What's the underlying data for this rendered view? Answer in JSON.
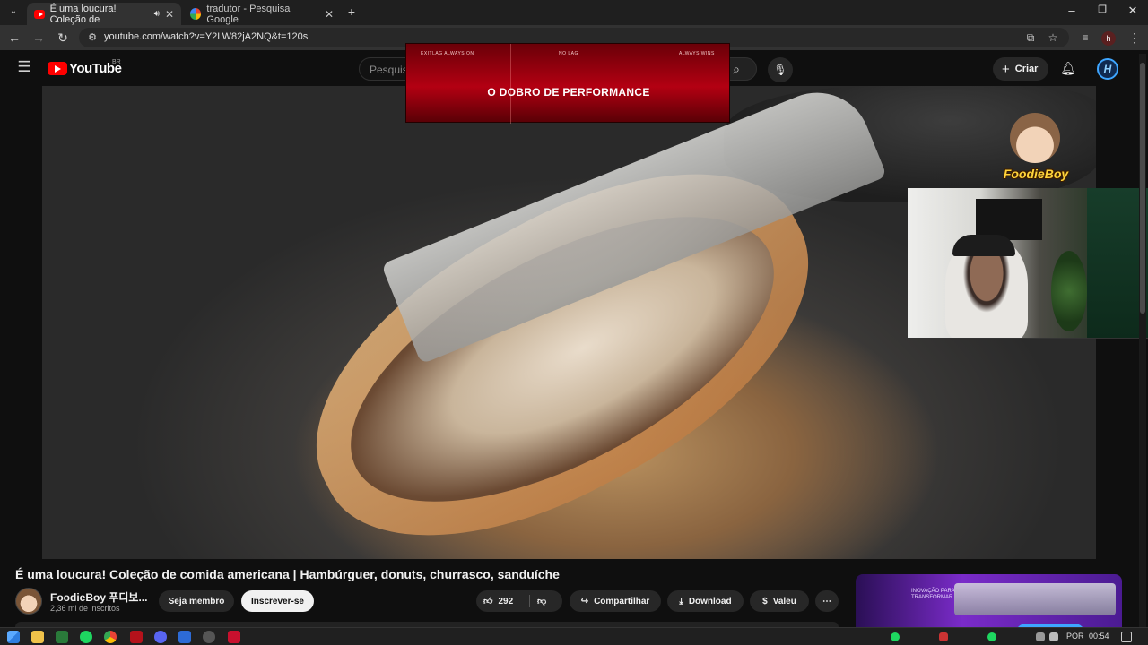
{
  "browser": {
    "tabs": [
      {
        "label": "É uma loucura! Coleção de",
        "active": true,
        "icon": "youtube-icon"
      },
      {
        "label": "tradutor - Pesquisa Google",
        "active": false,
        "icon": "google-icon"
      }
    ],
    "url": "youtube.com/watch?v=Y2LW82jA2NQ&t=120s",
    "profile_initial": "h"
  },
  "youtube": {
    "brand": "YouTube",
    "region": "BR",
    "search_placeholder": "Pesquisar",
    "create_label": "Criar"
  },
  "video_overlay": {
    "ad_small_texts": [
      "EXITLAG ALWAYS ON",
      "NO LAG",
      "ALWAYS WINS"
    ],
    "ad_headline": "O DOBRO DE PERFORMANCE",
    "channel_logo_text": "FoodieBoy"
  },
  "video_info": {
    "title": "É uma loucura! Coleção de comida americana | Hambúrguer, donuts, churrasco, sanduíche",
    "channel_name": "FoodieBoy 푸디보...",
    "subscribers": "2,36 mi de inscritos",
    "join_label": "Seja membro",
    "subscribe_label": "Inscrever-se",
    "like_count": "292",
    "share_label": "Compartilhar",
    "download_label": "Download",
    "thanks_label": "Valeu"
  },
  "side_ad": {
    "text": "INOVAÇÃO PARA TRANSFORMAR"
  },
  "taskbar": {
    "language": "POR",
    "time": "00:54"
  },
  "colors": {
    "youtube_red": "#ff0000",
    "accent_blue": "#3ea6ff",
    "ad_red": "#b30012"
  }
}
